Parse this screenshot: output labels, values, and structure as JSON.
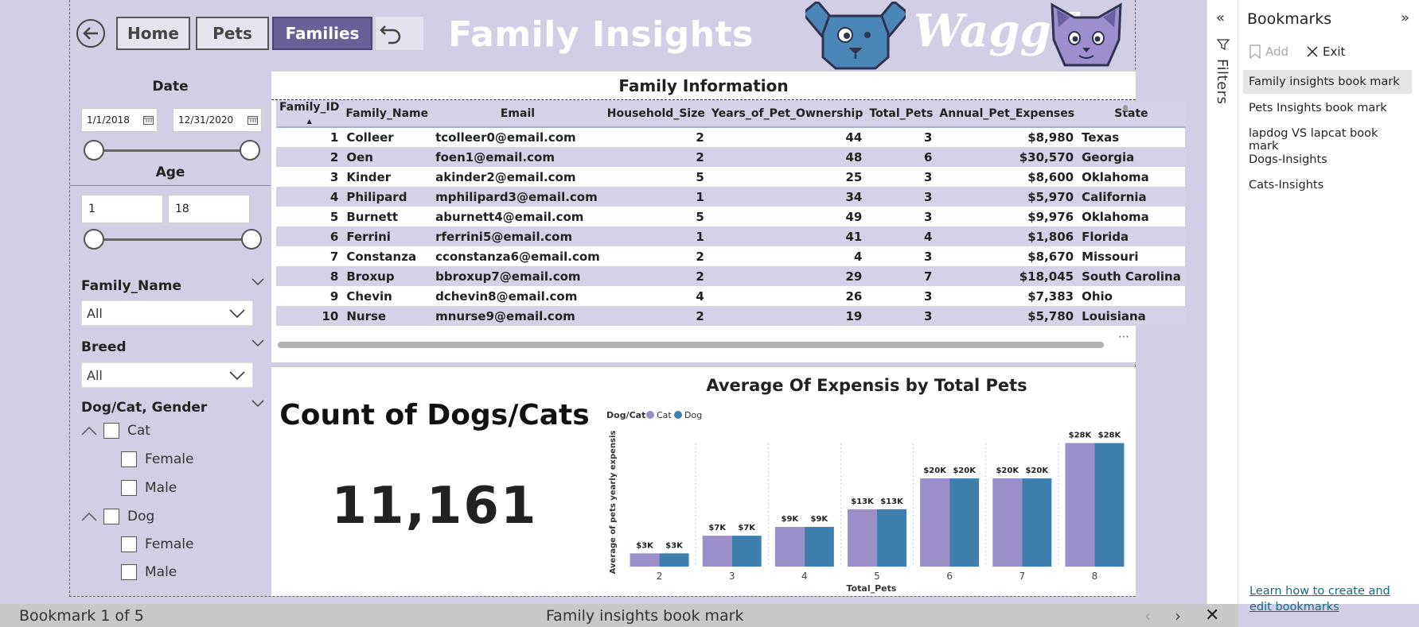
{
  "header": {
    "title": "Family Insights",
    "brand": "Wagg'le",
    "nav": [
      "Home",
      "Pets",
      "Families"
    ],
    "active_nav": "Families"
  },
  "filters": {
    "date": {
      "title": "Date",
      "start": "1/1/2018",
      "end": "12/31/2020"
    },
    "age": {
      "title": "Age",
      "min": "1",
      "max": "18"
    },
    "family_name": {
      "title": "Family_Name",
      "value": "All"
    },
    "breed": {
      "title": "Breed",
      "value": "All"
    },
    "dogcat_gender": {
      "title": "Dog/Cat, Gender",
      "groups": [
        {
          "label": "Cat",
          "children": [
            "Female",
            "Male"
          ]
        },
        {
          "label": "Dog",
          "children": [
            "Female",
            "Male"
          ]
        }
      ]
    }
  },
  "table": {
    "title": "Family Information",
    "columns": [
      "Family_ID",
      "Family_Name",
      "Email",
      "Household_Size",
      "Years_of_Pet_Ownership",
      "Total_Pets",
      "Annual_Pet_Expenses",
      "State"
    ],
    "rows": [
      [
        "1",
        "Colleer",
        "tcolleer0@email.com",
        "2",
        "44",
        "3",
        "$8,980",
        "Texas"
      ],
      [
        "2",
        "Oen",
        "foen1@email.com",
        "2",
        "48",
        "6",
        "$30,570",
        "Georgia"
      ],
      [
        "3",
        "Kinder",
        "akinder2@email.com",
        "5",
        "25",
        "3",
        "$8,600",
        "Oklahoma"
      ],
      [
        "4",
        "Philipard",
        "mphilipard3@email.com",
        "1",
        "34",
        "3",
        "$5,970",
        "California"
      ],
      [
        "5",
        "Burnett",
        "aburnett4@email.com",
        "5",
        "49",
        "3",
        "$9,976",
        "Oklahoma"
      ],
      [
        "6",
        "Ferrini",
        "rferrini5@email.com",
        "1",
        "41",
        "4",
        "$1,806",
        "Florida"
      ],
      [
        "7",
        "Constanza",
        "cconstanza6@email.com",
        "2",
        "4",
        "3",
        "$8,670",
        "Missouri"
      ],
      [
        "8",
        "Broxup",
        "bbroxup7@email.com",
        "2",
        "29",
        "7",
        "$18,045",
        "South Carolina"
      ],
      [
        "9",
        "Chevin",
        "dchevin8@email.com",
        "4",
        "26",
        "3",
        "$7,383",
        "Ohio"
      ],
      [
        "10",
        "Nurse",
        "mnurse9@email.com",
        "2",
        "19",
        "3",
        "$5,780",
        "Louisiana"
      ]
    ]
  },
  "card": {
    "title": "Count of Dogs/Cats",
    "value": "11,161"
  },
  "chart_data": {
    "type": "bar",
    "title": "Average Of Expensis by Total Pets",
    "xlabel": "Total_Pets",
    "ylabel": "Average of pets yearly expensis",
    "legend_title": "Dog/Cat",
    "legend_position": "top-left",
    "categories": [
      "2",
      "3",
      "4",
      "5",
      "6",
      "7",
      "8"
    ],
    "series": [
      {
        "name": "Cat",
        "color": "#9b8fc9",
        "values": [
          3000,
          7000,
          9000,
          13000,
          20000,
          20000,
          28000
        ],
        "labels": [
          "$3K",
          "$7K",
          "$9K",
          "$13K",
          "$20K",
          "$20K",
          "$28K"
        ]
      },
      {
        "name": "Dog",
        "color": "#3f7fad",
        "values": [
          3000,
          7000,
          9000,
          13000,
          20000,
          20000,
          28000
        ],
        "labels": [
          "$3K",
          "$7K",
          "$9K",
          "$13K",
          "$20K",
          "$20K",
          "$28K"
        ]
      }
    ],
    "ylim": [
      0,
      29000
    ],
    "grid": false
  },
  "filters_pane": {
    "label": "Filters"
  },
  "bookmarks": {
    "title": "Bookmarks",
    "add_label": "Add",
    "exit_label": "Exit",
    "items": [
      "Family insights book mark",
      "Pets Insights book mark",
      "lapdog VS lapcat book mark",
      "Dogs-Insights",
      "Cats-Insights"
    ],
    "selected_index": 0,
    "link": "Learn how to create and edit bookmarks"
  },
  "bottom_bar": {
    "count_text": "Bookmark 1 of 5",
    "name": "Family insights book mark"
  }
}
